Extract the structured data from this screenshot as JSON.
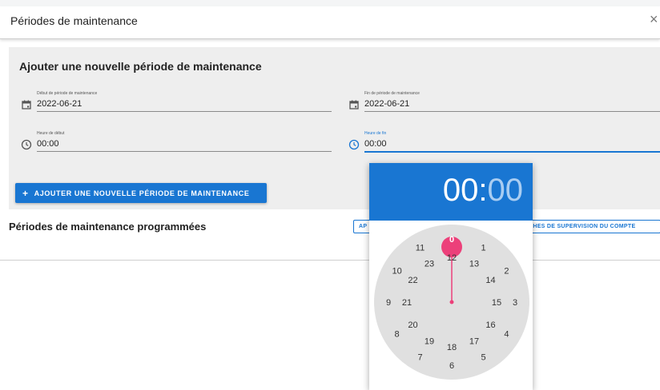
{
  "dialog": {
    "title": "Périodes de maintenance",
    "close_label": "×"
  },
  "add_section": {
    "title": "Ajouter une nouvelle période de maintenance",
    "start_date": {
      "label": "Début de période de maintenance",
      "value": "2022-06-21",
      "icon": "calendar-icon"
    },
    "end_date": {
      "label": "Fin de période de maintenance",
      "value": "2022-06-21",
      "icon": "calendar-icon"
    },
    "start_time": {
      "label": "Heure de début",
      "value": "00:00",
      "icon": "clock-icon"
    },
    "end_time": {
      "label": "Heure de fin",
      "value": "00:00",
      "icon": "clock-icon"
    },
    "add_button_label": "AJOUTER UNE NOUVELLE PÉRIODE DE MAINTENANCE",
    "add_button_icon": "+"
  },
  "scheduled": {
    "title": "Périodes de maintenance programmées",
    "button_left_label": "AP",
    "button_right_label": "CHES DE SUPERVISION DU COMPTE"
  },
  "time_picker": {
    "hours": "00",
    "separator": ":",
    "minutes": "00",
    "selected_hour": "0",
    "outer_hours": [
      "0",
      "1",
      "2",
      "3",
      "4",
      "5",
      "6",
      "7",
      "8",
      "9",
      "10",
      "11"
    ],
    "inner_hours": [
      "12",
      "13",
      "14",
      "15",
      "16",
      "17",
      "18",
      "19",
      "20",
      "21",
      "22",
      "23"
    ]
  },
  "colors": {
    "primary": "#1976d2",
    "selected_hand": "#ec407a",
    "clock_face": "#e0e0e0"
  }
}
